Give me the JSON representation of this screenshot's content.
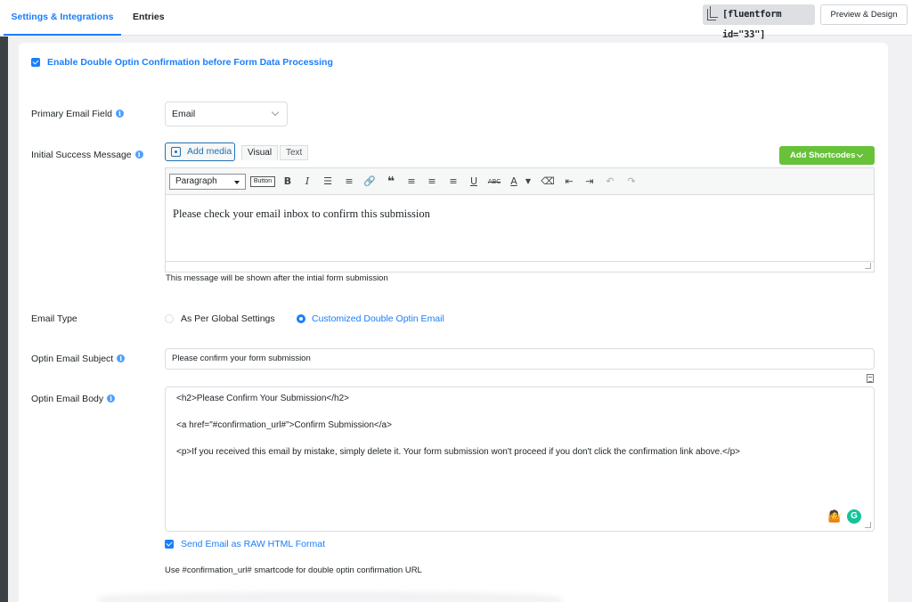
{
  "header": {
    "tabs": [
      {
        "label": "Settings & Integrations",
        "active": true
      },
      {
        "label": "Entries",
        "active": false
      }
    ],
    "shortcode": "[fluentform id=\"33\"]",
    "preview_label": "Preview & Design"
  },
  "form": {
    "enable_double_optin": {
      "label": "Enable Double Optin Confirmation before Form Data Processing",
      "checked": true
    },
    "primary_email": {
      "label": "Primary Email Field",
      "value": "Email"
    },
    "initial_message": {
      "label": "Initial Success Message",
      "add_media_label": "Add media",
      "tab_visual": "Visual",
      "tab_text": "Text",
      "add_shortcodes_label": "Add Shortcodes",
      "format_value": "Paragraph",
      "button_chip": "Button",
      "toolbar_icons": [
        "bold-icon",
        "italic-icon",
        "bullet-list-icon",
        "numbered-list-icon",
        "link-icon",
        "blockquote-icon",
        "align-left-icon",
        "align-center-icon",
        "align-right-icon",
        "underline-icon",
        "strikethrough-icon",
        "text-color-icon",
        "clear-format-icon",
        "outdent-icon",
        "indent-icon",
        "undo-icon",
        "redo-icon"
      ],
      "content": "Please check your email inbox to confirm this submission",
      "hint": "This message will be shown after the intial form submission"
    },
    "email_type": {
      "label": "Email Type",
      "options": [
        {
          "label": "As Per Global Settings",
          "selected": false
        },
        {
          "label": "Customized Double Optin Email",
          "selected": true
        }
      ]
    },
    "subject": {
      "label": "Optin Email Subject",
      "value": "Please confirm your form submission"
    },
    "body": {
      "label": "Optin Email Body",
      "lines": [
        "<h2>Please Confirm Your Submission</h2>",
        "<a href=\"#confirmation_url#\">Confirm Submission</a>",
        "<p>If you received this email by mistake, simply delete it. Your form submission won't proceed if you don't click the confirmation link above.</p>"
      ]
    },
    "raw_html": {
      "label": "Send Email as RAW HTML Format",
      "checked": true
    },
    "footer_hint": "Use #confirmation_url# smartcode for double optin confirmation URL"
  },
  "colors": {
    "accent": "#1a7efb",
    "success": "#67c23a"
  }
}
